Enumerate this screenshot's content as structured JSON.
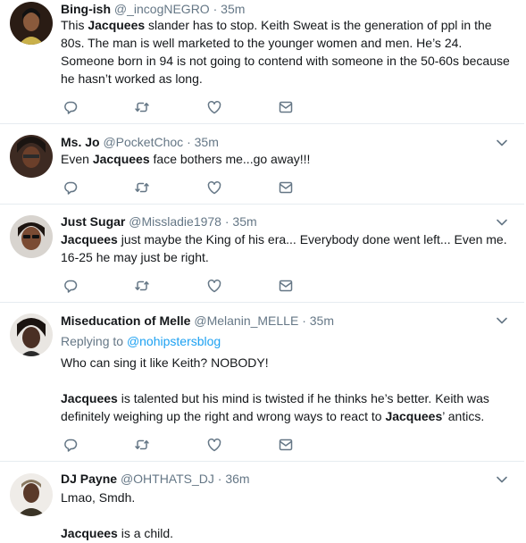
{
  "tweets": [
    {
      "display_name": "Bing-ish",
      "handle": "@_incogNEGRO",
      "separator": "·",
      "time": "35m",
      "body_html": "This <b>Jacquees</b> slander has to stop. Keith Sweat is the generation of ppl in the 80s. The man is well marketed to the younger women and men. He’s 24. Someone born in 94 is not going to contend with someone in the 50-60s because he hasn’t worked as long."
    },
    {
      "display_name": "Ms. Jo",
      "handle": "@PocketChoc",
      "separator": "·",
      "time": "35m",
      "body_html": "Even <b>Jacquees</b> face bothers me...go away!!!"
    },
    {
      "display_name": "Just Sugar",
      "handle": "@Missladie1978",
      "separator": "·",
      "time": "35m",
      "body_html": "<b>Jacquees</b> just maybe the King of his era...  Everybody done went left... Even me. 16-25 he may just be right."
    },
    {
      "display_name": "Miseducation of Melle",
      "handle": "@Melanin_MELLE",
      "separator": "·",
      "time": "35m",
      "replying_label": "Replying to",
      "replying_handle": "@nohipstersblog",
      "body_html": "Who can sing it like Keith? NOBODY!<span class='gap'></span><b>Jacquees</b> is talented but his mind is twisted if he thinks he’s better. Keith was definitely weighing up the right and wrong ways to react to <b>Jacquees</b>’ antics."
    },
    {
      "display_name": "DJ Payne",
      "handle": "@OHTHATS_DJ",
      "separator": "·",
      "time": "36m",
      "body_html": "Lmao, Smdh.<span class='gap'></span><b>Jacquees</b> is a child."
    }
  ],
  "icons": [
    "reply-icon",
    "retweet-icon",
    "like-icon",
    "dm-icon",
    "chevron-down-icon"
  ],
  "colors": {
    "text": "#14171a",
    "muted": "#657786",
    "link": "#1da1f2",
    "divider": "#e6ecf0"
  }
}
